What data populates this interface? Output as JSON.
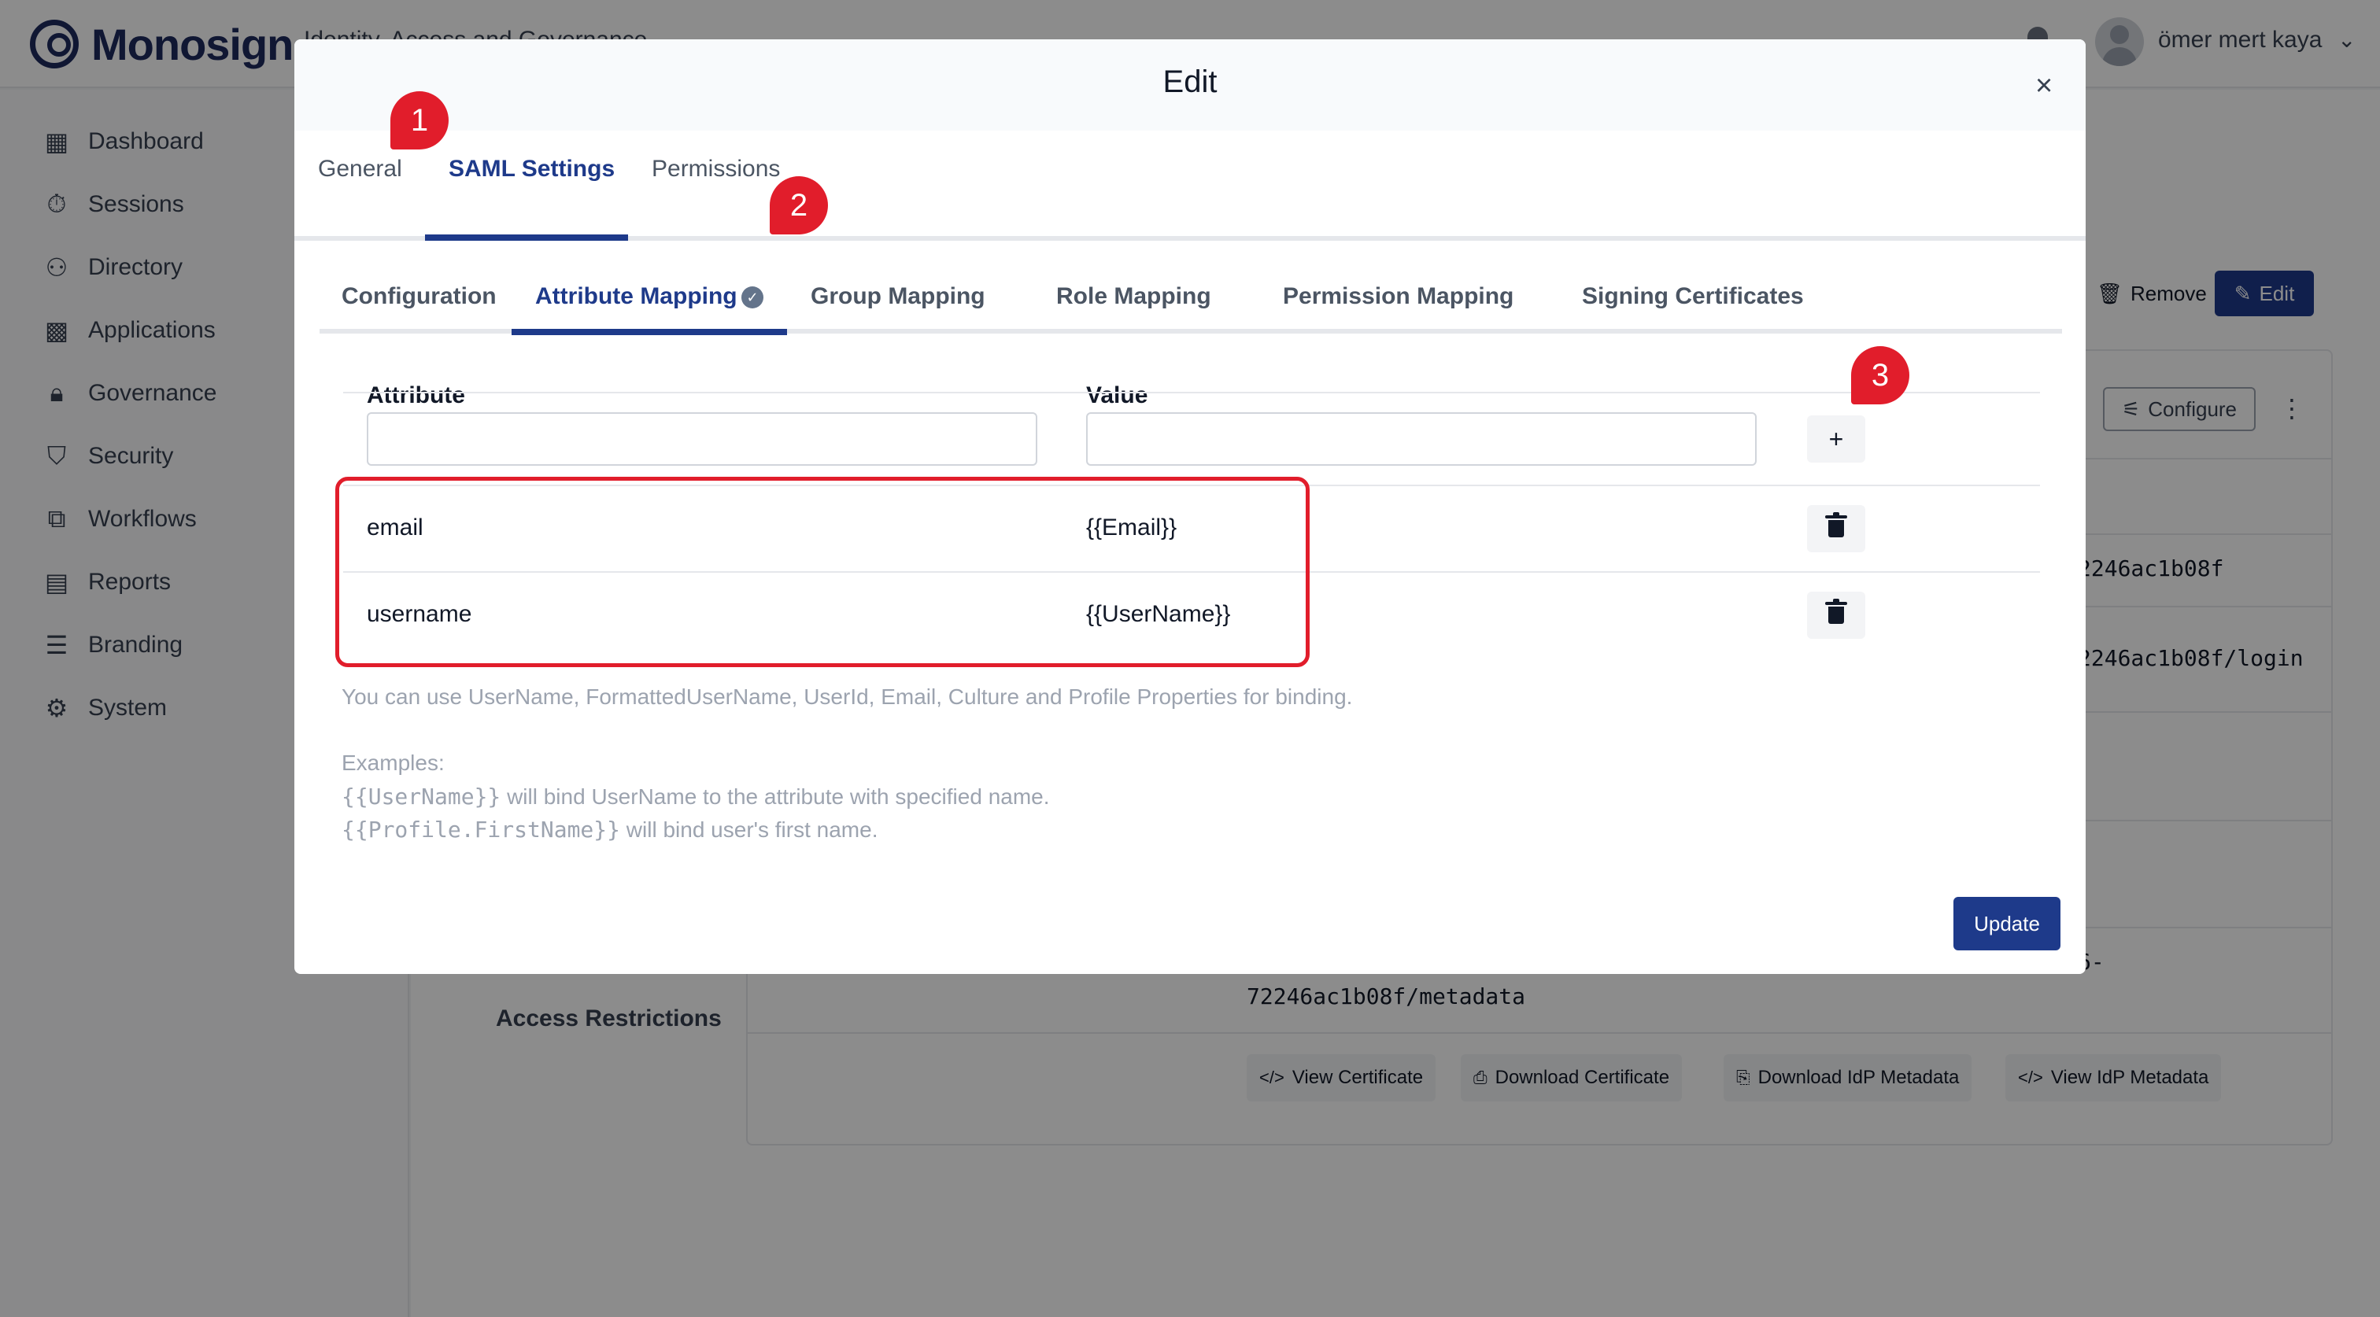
{
  "app": {
    "brand": "Monosign",
    "subtitle": "Identity, Access and Governance",
    "user_name": "ömer mert kaya"
  },
  "sidebar": {
    "items": [
      {
        "label": "Dashboard",
        "icon": "dashboard-icon"
      },
      {
        "label": "Sessions",
        "icon": "stopwatch-icon"
      },
      {
        "label": "Directory",
        "icon": "users-icon"
      },
      {
        "label": "Applications",
        "icon": "grid-icon"
      },
      {
        "label": "Governance",
        "icon": "lock-icon"
      },
      {
        "label": "Security",
        "icon": "shield-icon"
      },
      {
        "label": "Workflows",
        "icon": "workflow-icon"
      },
      {
        "label": "Reports",
        "icon": "reports-icon"
      },
      {
        "label": "Branding",
        "icon": "branding-icon"
      },
      {
        "label": "System",
        "icon": "gear-icon"
      }
    ]
  },
  "background": {
    "remove_label": "Remove",
    "edit_label": "Edit",
    "configure_label": "Configure",
    "url_fragment_1": "2246ac1b08f",
    "url_fragment_2": "2246ac1b08f/login",
    "url_fragment_3": "6-",
    "metadata_url_tail": "72246ac1b08f/metadata",
    "access_restrictions": "Access Restrictions",
    "buttons": {
      "view_certificate": "View Certificate",
      "download_certificate": "Download Certificate",
      "download_idp_metadata": "Download IdP Metadata",
      "view_idp_metadata": "View IdP Metadata"
    }
  },
  "modal": {
    "title": "Edit",
    "close_glyph": "×",
    "tabs": [
      "General",
      "SAML Settings",
      "Permissions"
    ],
    "subtabs": [
      "Configuration",
      "Attribute Mapping",
      "Group Mapping",
      "Role Mapping",
      "Permission Mapping",
      "Signing Certificates"
    ],
    "table": {
      "headers": {
        "attribute": "Attribute",
        "value": "Value"
      },
      "new_attribute": "",
      "new_value": "",
      "add_glyph": "+",
      "rows": [
        {
          "attribute": "email",
          "value": "{{Email}}"
        },
        {
          "attribute": "username",
          "value": "{{UserName}}"
        }
      ]
    },
    "hint_line": "You can use UserName, FormattedUserName, UserId, Email, Culture and Profile Properties for binding.",
    "examples_label": "Examples:",
    "example_1_code": "{{UserName}}",
    "example_1_text": " will bind UserName to the attribute with specified name.",
    "example_2_code": "{{Profile.FirstName}}",
    "example_2_text": " will bind user's first name.",
    "update_label": "Update"
  },
  "annotations": {
    "badge_1": "1",
    "badge_2": "2",
    "badge_3": "3",
    "color": "#e11d2b"
  }
}
